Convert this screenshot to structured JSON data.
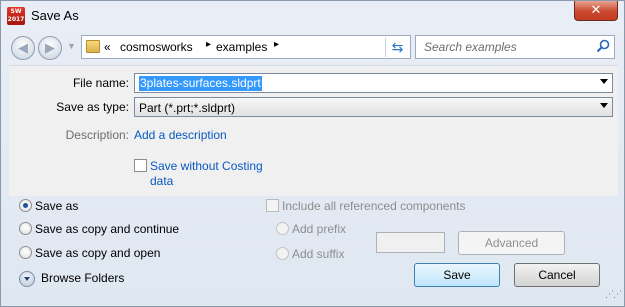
{
  "window": {
    "title": "Save As",
    "app_icon_text": "SW 2017",
    "close_glyph": "✕"
  },
  "nav": {
    "back_glyph": "◀",
    "forward_glyph": "▶",
    "dropdown_glyph": "▼",
    "breadcrumb_prefix": "«",
    "breadcrumb": [
      "cosmosworks",
      "examples"
    ],
    "separator": "▸",
    "breadcrumb_dropdown": "▼",
    "refresh_glyph": "⇆"
  },
  "search": {
    "placeholder": "Search examples"
  },
  "form": {
    "file_name_label": "File name:",
    "file_name_value": "3plates-surfaces.sldprt",
    "save_as_type_label": "Save as type:",
    "save_as_type_value": "Part (*.prt;*.sldprt)",
    "description_label": "Description:",
    "description_link": "Add a description",
    "costing_line1": "Save without Costing",
    "costing_line2": "data"
  },
  "options": {
    "save_as": "Save as",
    "save_as_copy_continue": "Save as copy and continue",
    "save_as_copy_open": "Save as copy and open",
    "selected": "Save as",
    "include_components": "Include all referenced components",
    "add_prefix": "Add prefix",
    "add_suffix": "Add suffix",
    "advanced": "Advanced"
  },
  "footer": {
    "browse_folders": "Browse Folders",
    "save": "Save",
    "cancel": "Cancel"
  }
}
